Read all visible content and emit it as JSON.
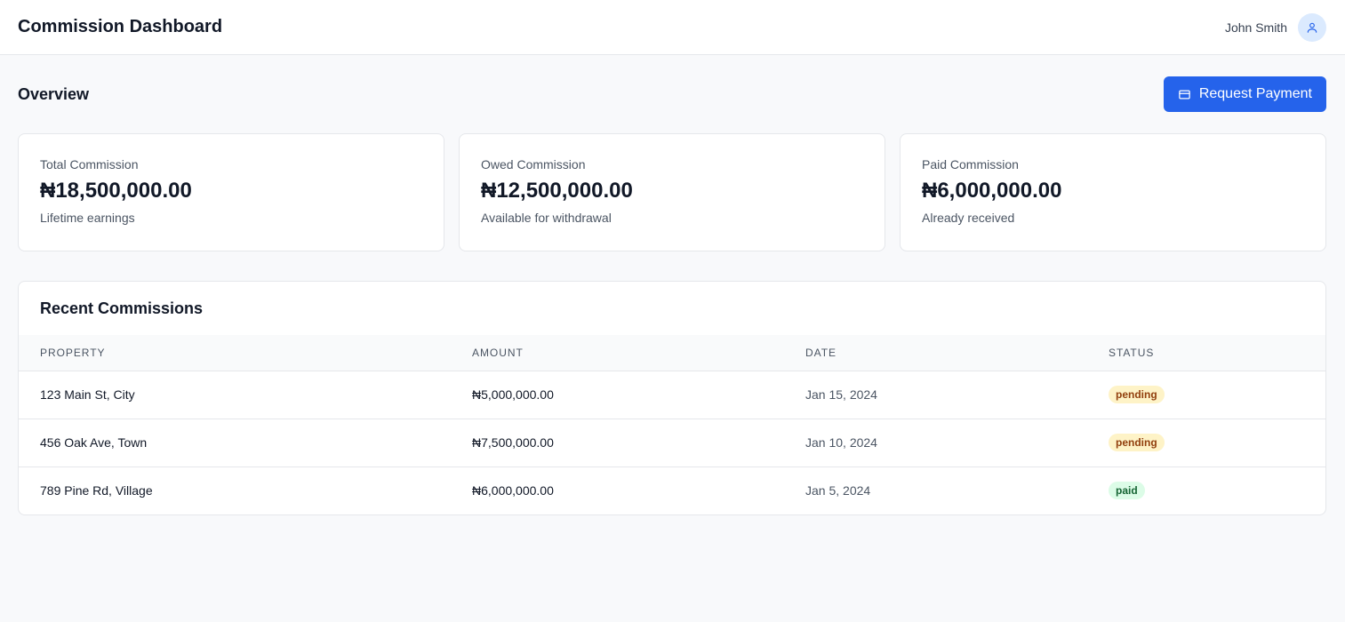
{
  "header": {
    "title": "Commission Dashboard",
    "user_name": "John Smith",
    "avatar_icon": "user-icon"
  },
  "overview": {
    "title": "Overview",
    "request_button": {
      "label": "Request Payment",
      "icon": "wallet-icon",
      "color": "#2563eb"
    }
  },
  "cards": [
    {
      "label": "Total Commission",
      "value": "₦18,500,000.00",
      "sub": "Lifetime earnings"
    },
    {
      "label": "Owed Commission",
      "value": "₦12,500,000.00",
      "sub": "Available for withdrawal"
    },
    {
      "label": "Paid Commission",
      "value": "₦6,000,000.00",
      "sub": "Already received"
    }
  ],
  "recent": {
    "title": "Recent Commissions",
    "columns": [
      "PROPERTY",
      "AMOUNT",
      "DATE",
      "STATUS"
    ],
    "rows": [
      {
        "property": "123 Main St, City",
        "amount": "₦5,000,000.00",
        "date": "Jan 15, 2024",
        "status": "pending"
      },
      {
        "property": "456 Oak Ave, Town",
        "amount": "₦7,500,000.00",
        "date": "Jan 10, 2024",
        "status": "pending"
      },
      {
        "property": "789 Pine Rd, Village",
        "amount": "₦6,000,000.00",
        "date": "Jan 5, 2024",
        "status": "paid"
      }
    ]
  },
  "colors": {
    "accent": "#2563eb",
    "pending_bg": "#fef3c7",
    "pending_text": "#92400e",
    "paid_bg": "#dcfce7",
    "paid_text": "#166534"
  }
}
